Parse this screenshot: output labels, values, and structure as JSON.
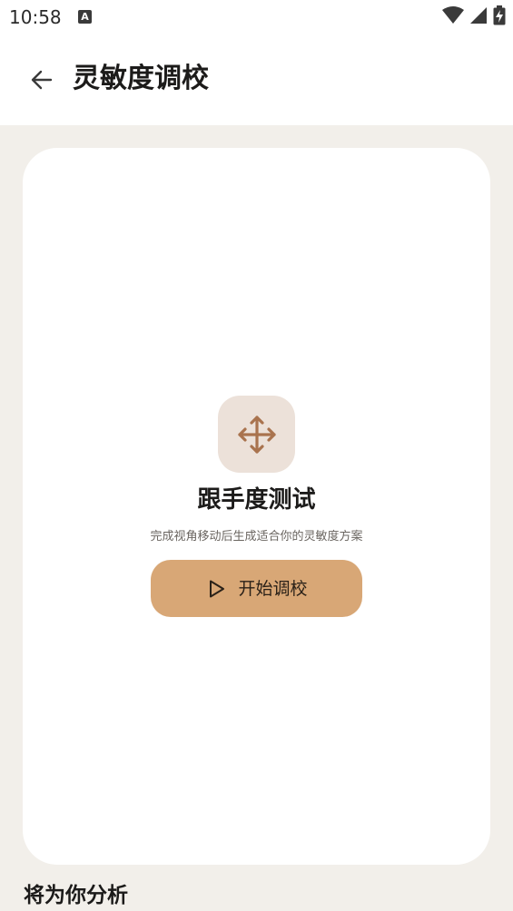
{
  "status_bar": {
    "time": "10:58",
    "notification_badge": "A"
  },
  "app_bar": {
    "title": "灵敏度调校"
  },
  "card": {
    "icon": "move-arrows-icon",
    "title": "跟手度测试",
    "subtitle": "完成视角移动后生成适合你的灵敏度方案",
    "button_label": "开始调校"
  },
  "section": {
    "title": "将为你分析"
  },
  "colors": {
    "page_background": "#f2efea",
    "accent": "#d8a776",
    "icon_tile": "#ece1d9",
    "icon_stroke": "#a9734e"
  }
}
